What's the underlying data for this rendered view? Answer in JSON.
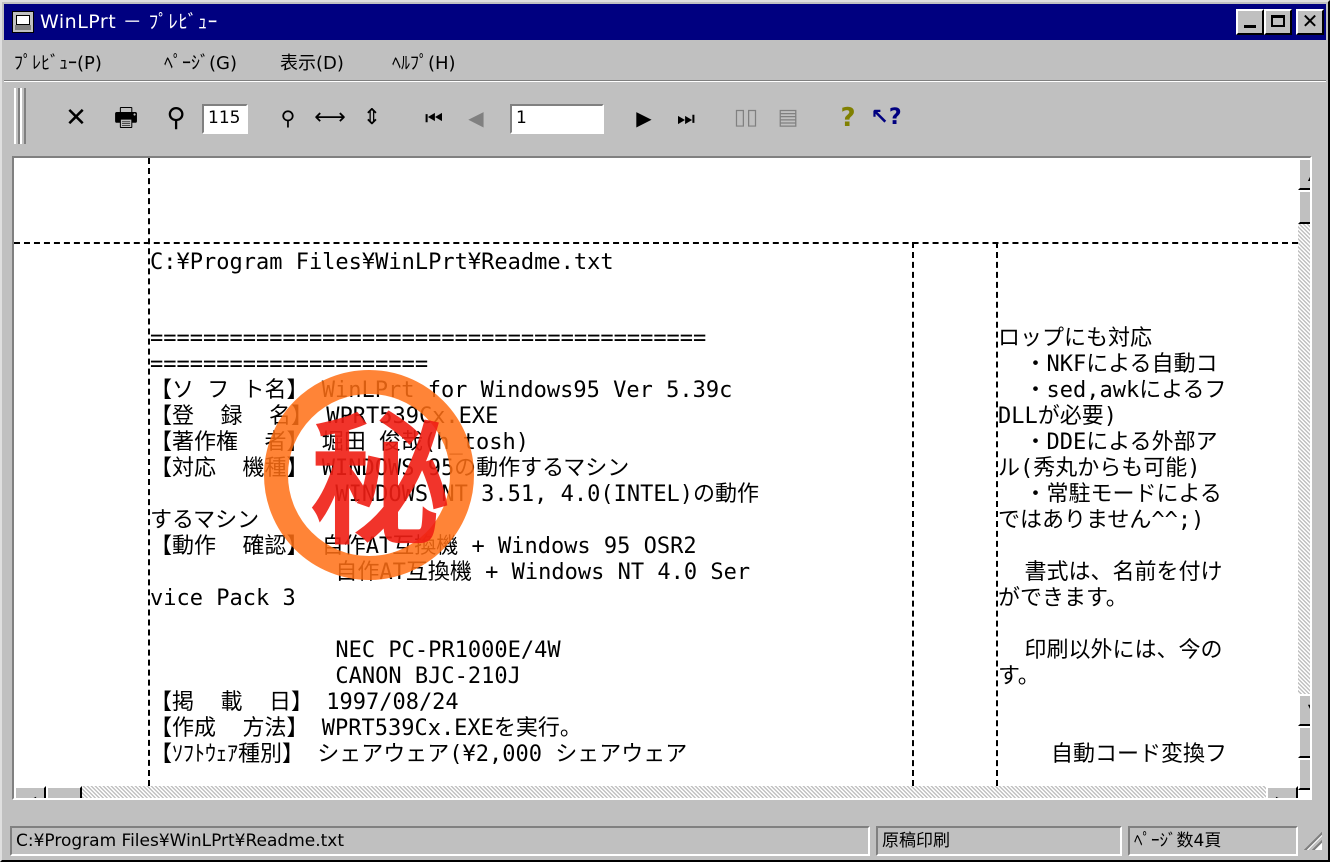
{
  "window": {
    "title": "WinLPrt － ﾌﾟﾚﾋﾞｭｰ"
  },
  "menus": [
    "ﾌﾟﾚﾋﾞｭｰ(P)",
    "ﾍﾟｰｼﾞ(G)",
    "表示(D)",
    "ﾍﾙﾌﾟ(H)"
  ],
  "toolbar": {
    "zoom_value": "115",
    "page_value": "1"
  },
  "document": {
    "header": "C:¥Program Files¥WinLPrt¥Readme.txt",
    "stamp_char": "秘",
    "col1": [
      "==========================================",
      "=====================",
      "【ソ フ ト名】 WinLPrt for Windows95 Ver 5.39c",
      "【登  録  名】 WPRT539Cx.EXE",
      "【著作権  者】 堀田 俊哉(h_tosh)",
      "【対応  機種】 WINDOWS 95の動作するマシン",
      "              WINDOWS NT 3.51, 4.0(INTEL)の動作",
      "するマシン",
      "【動作  確認】 自作AT互換機 + Windows 95 OSR2",
      "              自作AT互換機 + Windows NT 4.0 Ser",
      "vice Pack 3",
      "              NEC PC-PR1000E/4W",
      "              CANON BJC-210J",
      "【掲  載  日】 1997/08/24",
      "【作成  方法】 WPRT539Cx.EXEを実行。",
      "【ｿﾌﾄｳｪｱ種別】 シェアウェア(¥2,000 シェアウェア"
    ],
    "col2": [
      "ロップにも対応",
      "  ・NKFによる自動コ",
      "  ・sed,awkによるフ",
      "DLLが必要)",
      "  ・DDEによる外部ア",
      "ル(秀丸からも可能)",
      "  ・常駐モードによる",
      "ではありません^^;)",
      "",
      "  書式は、名前を付け",
      "ができます。",
      "",
      "  印刷以外には、今の",
      "す。",
      "",
      "    自動コード変換フ"
    ]
  },
  "status": {
    "path": "C:¥Program Files¥WinLPrt¥Readme.txt",
    "mode": "原稿印刷",
    "pages": "ﾍﾟｰｼﾞ数4頁"
  }
}
